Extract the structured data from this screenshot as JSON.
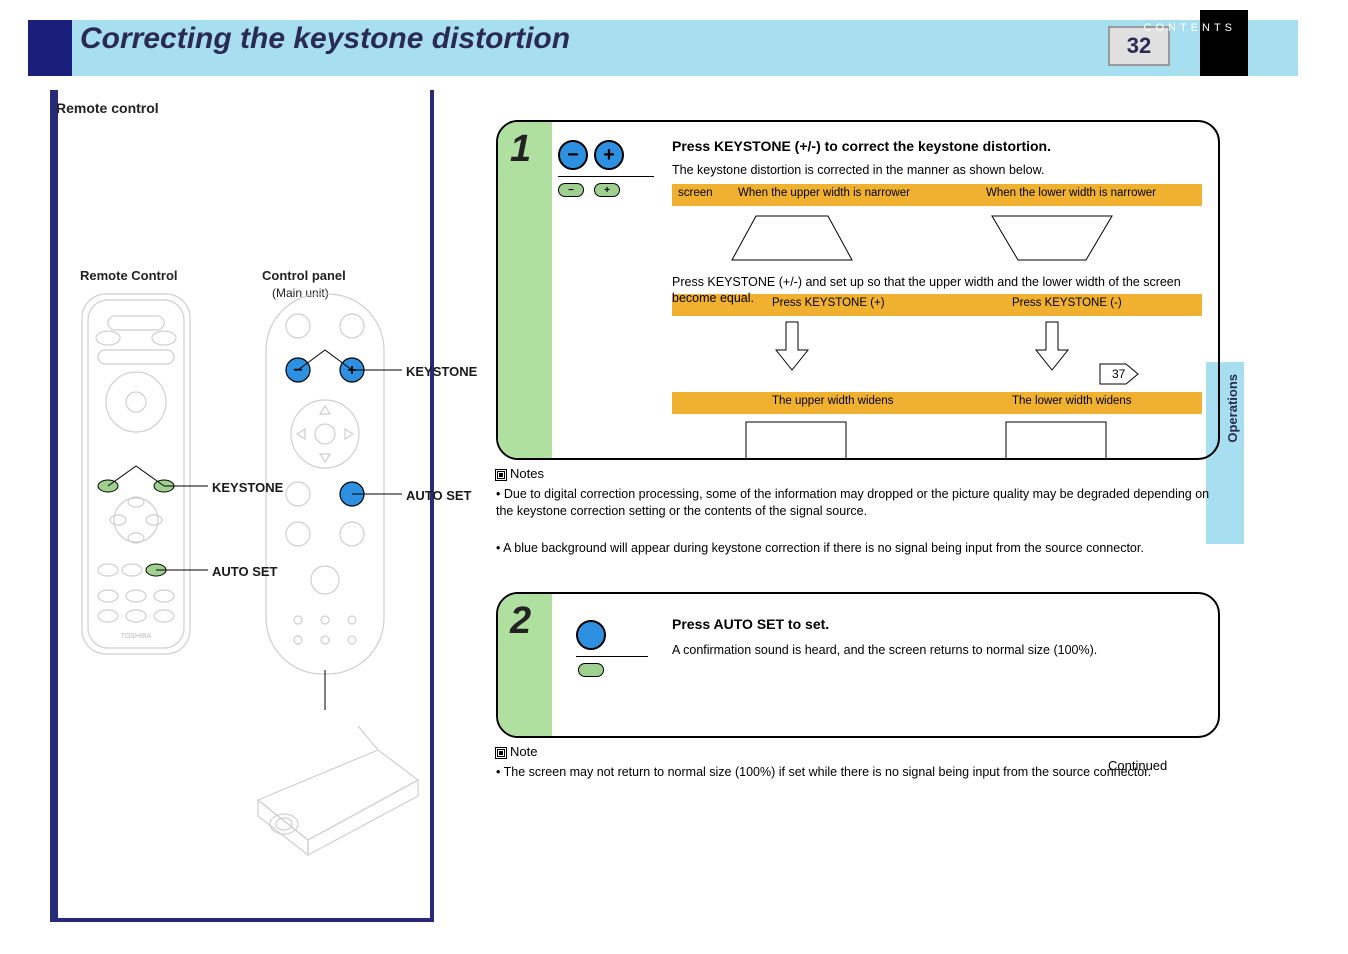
{
  "page": {
    "number": "32",
    "contents_tab": "CONTENTS",
    "side_tab": "Operations",
    "header_title": "Correcting the keystone distortion"
  },
  "left": {
    "remote_bold": "Remote control",
    "remote_sub": "Remote Control",
    "control_panel": "Control panel",
    "main_unit": "(Main unit)",
    "labels": {
      "keystone_left": "KEYSTONE",
      "keystone_right": "KEYSTONE",
      "autoset_left": "AUTO SET",
      "autoset_right": "AUTO SET"
    }
  },
  "box1": {
    "num": "1",
    "title": "Press KEYSTONE (+/-) to correct the keystone distortion.",
    "line2_pre": "The keystone distortion is corrected in the manner as shown below.",
    "line2_arrow": "37",
    "line3_instr": "Press KEYSTONE (+/-) and set up so that the upper width and the lower width of the screen become equal.",
    "bar1_label": "screen",
    "bar1_a": "When the upper width is narrower",
    "bar1_b": "When the lower width is narrower",
    "bar2_a": "Press KEYSTONE (+)",
    "bar2_b": "Press KEYSTONE (-)",
    "bar3_a": "The upper width widens",
    "bar3_b": "The lower width widens",
    "icons": {
      "minus": "−",
      "plus": "+",
      "minus_sm": "−",
      "plus_sm": "+"
    }
  },
  "notes1": {
    "header": "Notes",
    "l1": "• Due to digital correction processing, some of the information may dropped or the picture quality may be degraded depending on the keystone correction setting or the contents of the signal source.",
    "l2": "• A blue background will appear during keystone correction if there is no signal being input from the source connector."
  },
  "box2": {
    "num": "2",
    "title": "Press AUTO SET to set.",
    "line2": "A confirmation sound is heard, and the screen returns to normal size (100%)."
  },
  "notes2": {
    "header": "Note",
    "l1": "• The screen may not return to normal size (100%) if set while there is no signal being input from the source connector."
  },
  "continued": "Continued"
}
